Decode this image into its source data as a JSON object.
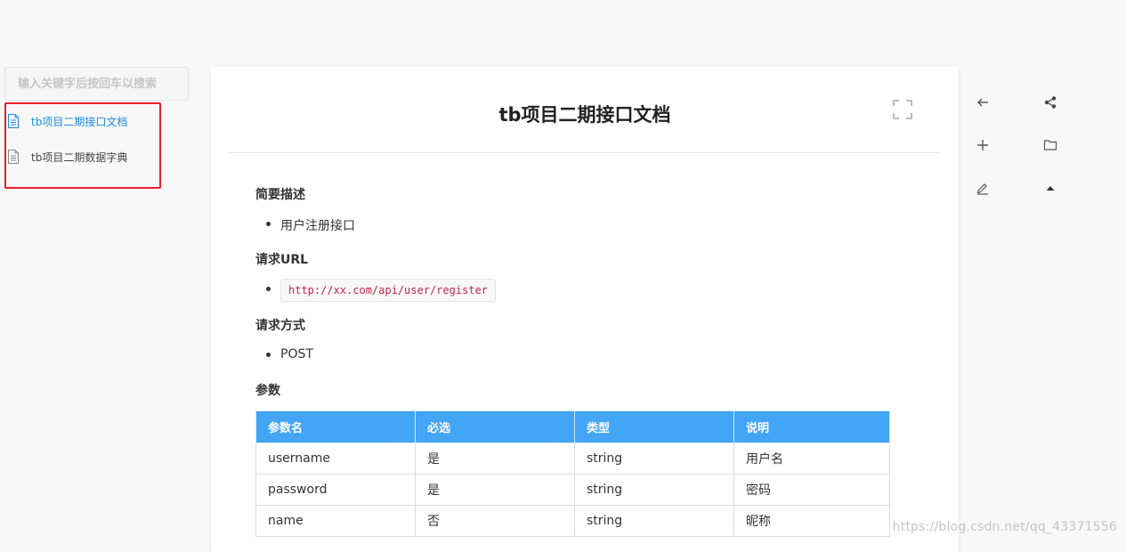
{
  "search": {
    "placeholder": "输入关键字后按回车以搜索",
    "value": ""
  },
  "sidebar": {
    "items": [
      {
        "label": "tb项目二期接口文档",
        "active": true,
        "icon": "document-icon"
      },
      {
        "label": "tb项目二期数据字典",
        "active": false,
        "icon": "document-icon"
      }
    ]
  },
  "doc": {
    "title": "tb项目二期接口文档",
    "sections": {
      "summary_heading": "简要描述",
      "summary_item": "用户注册接口",
      "url_heading": "请求URL",
      "url_item": "http://xx.com/api/user/register",
      "method_heading": "请求方式",
      "method_item": "POST",
      "params_heading": "参数"
    },
    "table": {
      "headers": [
        "参数名",
        "必选",
        "类型",
        "说明"
      ],
      "rows": [
        [
          "username",
          "是",
          "string",
          "用户名"
        ],
        [
          "password",
          "是",
          "string",
          "密码"
        ],
        [
          "name",
          "否",
          "string",
          "昵称"
        ]
      ]
    }
  },
  "toolbar": {
    "icons": [
      "back-arrow-icon",
      "share-icon",
      "plus-icon",
      "folder-icon",
      "edit-icon",
      "scroll-top-icon"
    ]
  },
  "watermark": "https://blog.csdn.net/qq_43371556",
  "colors": {
    "accent": "#1e88e5",
    "table_header": "#42a5f5",
    "highlight_box": "#e8212b",
    "code": "#c7254e"
  }
}
